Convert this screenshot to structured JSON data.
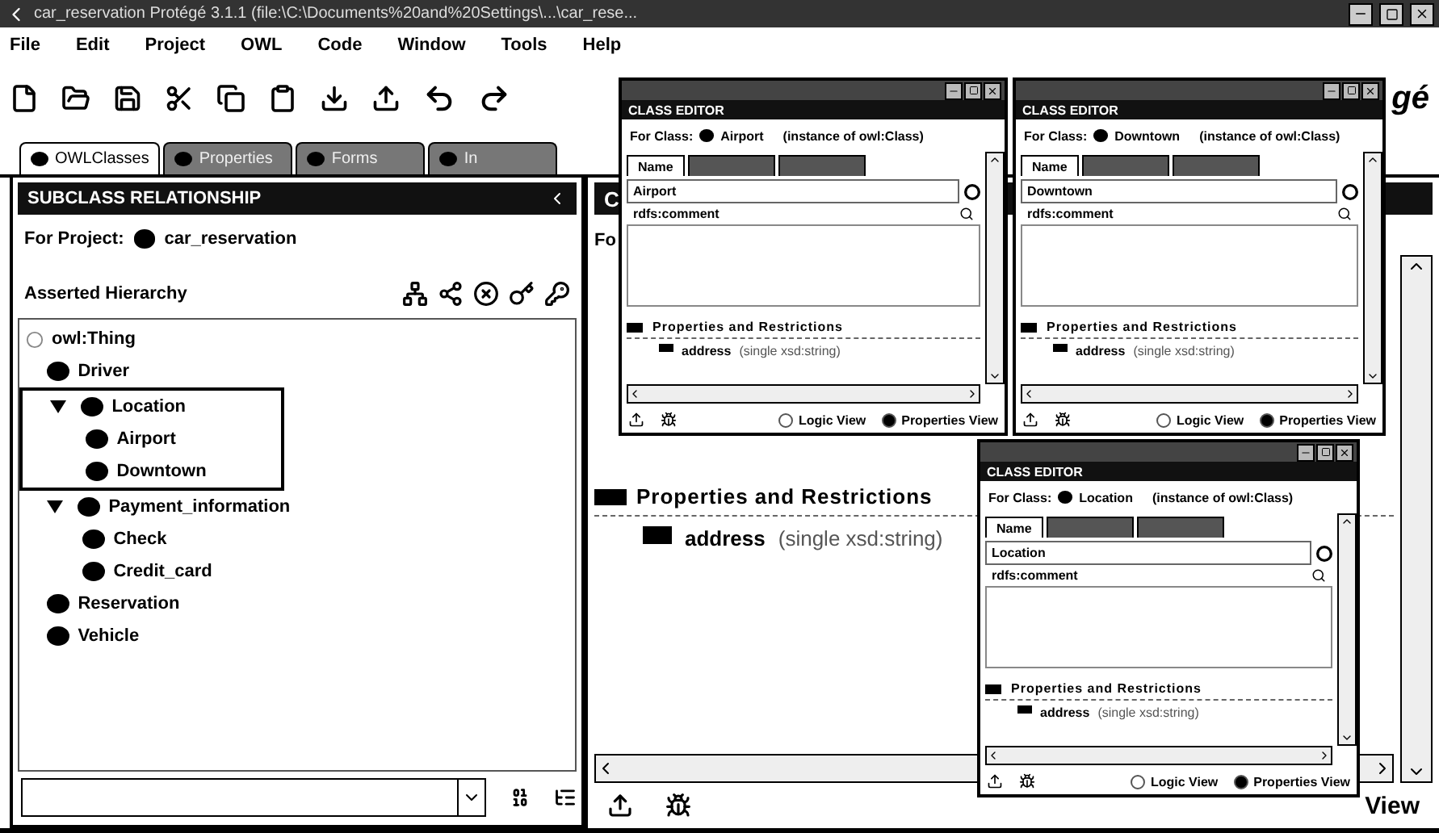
{
  "window": {
    "title": "car_reservation  Protégé 3.1.1   (file:\\C:\\Documents%20and%20Settings\\...\\car_rese..."
  },
  "menu": [
    "File",
    "Edit",
    "Project",
    "OWL",
    "Code",
    "Window",
    "Tools",
    "Help"
  ],
  "logo": "gé",
  "tabs": [
    {
      "label": "OWLClasses",
      "selected": true
    },
    {
      "label": "Properties",
      "selected": false
    },
    {
      "label": "Forms",
      "selected": false
    },
    {
      "label": "In",
      "selected": false
    }
  ],
  "class_tree_panel": {
    "header": "SUBCLASS RELATIONSHIP",
    "project_label": "For Project:",
    "project_name": "car_reservation",
    "hierarchy_label": "Asserted Hierarchy",
    "tree": [
      {
        "label": "owl:Thing",
        "highlighted": false,
        "children": [
          {
            "label": "Driver",
            "highlighted": false
          },
          {
            "label": "Location",
            "expanded": true,
            "highlighted": true,
            "children": [
              {
                "label": "Airport",
                "highlighted": false
              },
              {
                "label": "Downtown",
                "highlighted": false
              }
            ]
          },
          {
            "label": "Payment_information",
            "expanded": true,
            "highlighted": false,
            "children": [
              {
                "label": "Check",
                "highlighted": false
              },
              {
                "label": "Credit_card",
                "highlighted": false
              }
            ]
          },
          {
            "label": "Reservation",
            "highlighted": false
          },
          {
            "label": "Vehicle",
            "highlighted": false
          }
        ]
      }
    ]
  },
  "class_editor": {
    "header": "C",
    "for_label": "Fo",
    "section": "Properties and Restrictions",
    "properties": [
      {
        "name": "address",
        "type": "(single xsd:string)"
      }
    ],
    "view_label": "View"
  },
  "editors": [
    {
      "header": "CLASS EDITOR",
      "for_label": "For Class:",
      "class_name": "Airport",
      "type_text": "(instance of owl:Class)",
      "tabs": [
        {
          "label": "Name",
          "selected": true
        },
        {
          "selected": false
        },
        {
          "selected": false
        }
      ],
      "name_value": "Airport",
      "comment_label": "rdfs:comment",
      "section": "Properties and Restrictions",
      "properties": [
        {
          "name": "address",
          "type": "(single xsd:string)"
        }
      ],
      "views": [
        {
          "label": "Logic View",
          "selected": false
        },
        {
          "label": "Properties View",
          "selected": true
        }
      ]
    },
    {
      "header": "CLASS EDITOR",
      "for_label": "For Class:",
      "class_name": "Downtown",
      "type_text": "(instance of owl:Class)",
      "tabs": [
        {
          "label": "Name",
          "selected": true
        },
        {
          "selected": false
        },
        {
          "selected": false
        }
      ],
      "name_value": "Downtown",
      "comment_label": "rdfs:comment",
      "section": "Properties and Restrictions",
      "properties": [
        {
          "name": "address",
          "type": "(single xsd:string)"
        }
      ],
      "views": [
        {
          "label": "Logic View",
          "selected": false
        },
        {
          "label": "Properties View",
          "selected": true
        }
      ]
    },
    {
      "header": "CLASS EDITOR",
      "for_label": "For Class:",
      "class_name": "Location",
      "type_text": "(instance of owl:Class)",
      "tabs": [
        {
          "label": "Name",
          "selected": true
        },
        {
          "selected": false
        },
        {
          "selected": false
        }
      ],
      "name_value": "Location",
      "comment_label": "rdfs:comment",
      "section": "Properties and Restrictions",
      "properties": [
        {
          "name": "address",
          "type": "(single xsd:string)"
        }
      ],
      "views": [
        {
          "label": "Logic View",
          "selected": false
        },
        {
          "label": "Properties View",
          "selected": true
        }
      ]
    }
  ]
}
